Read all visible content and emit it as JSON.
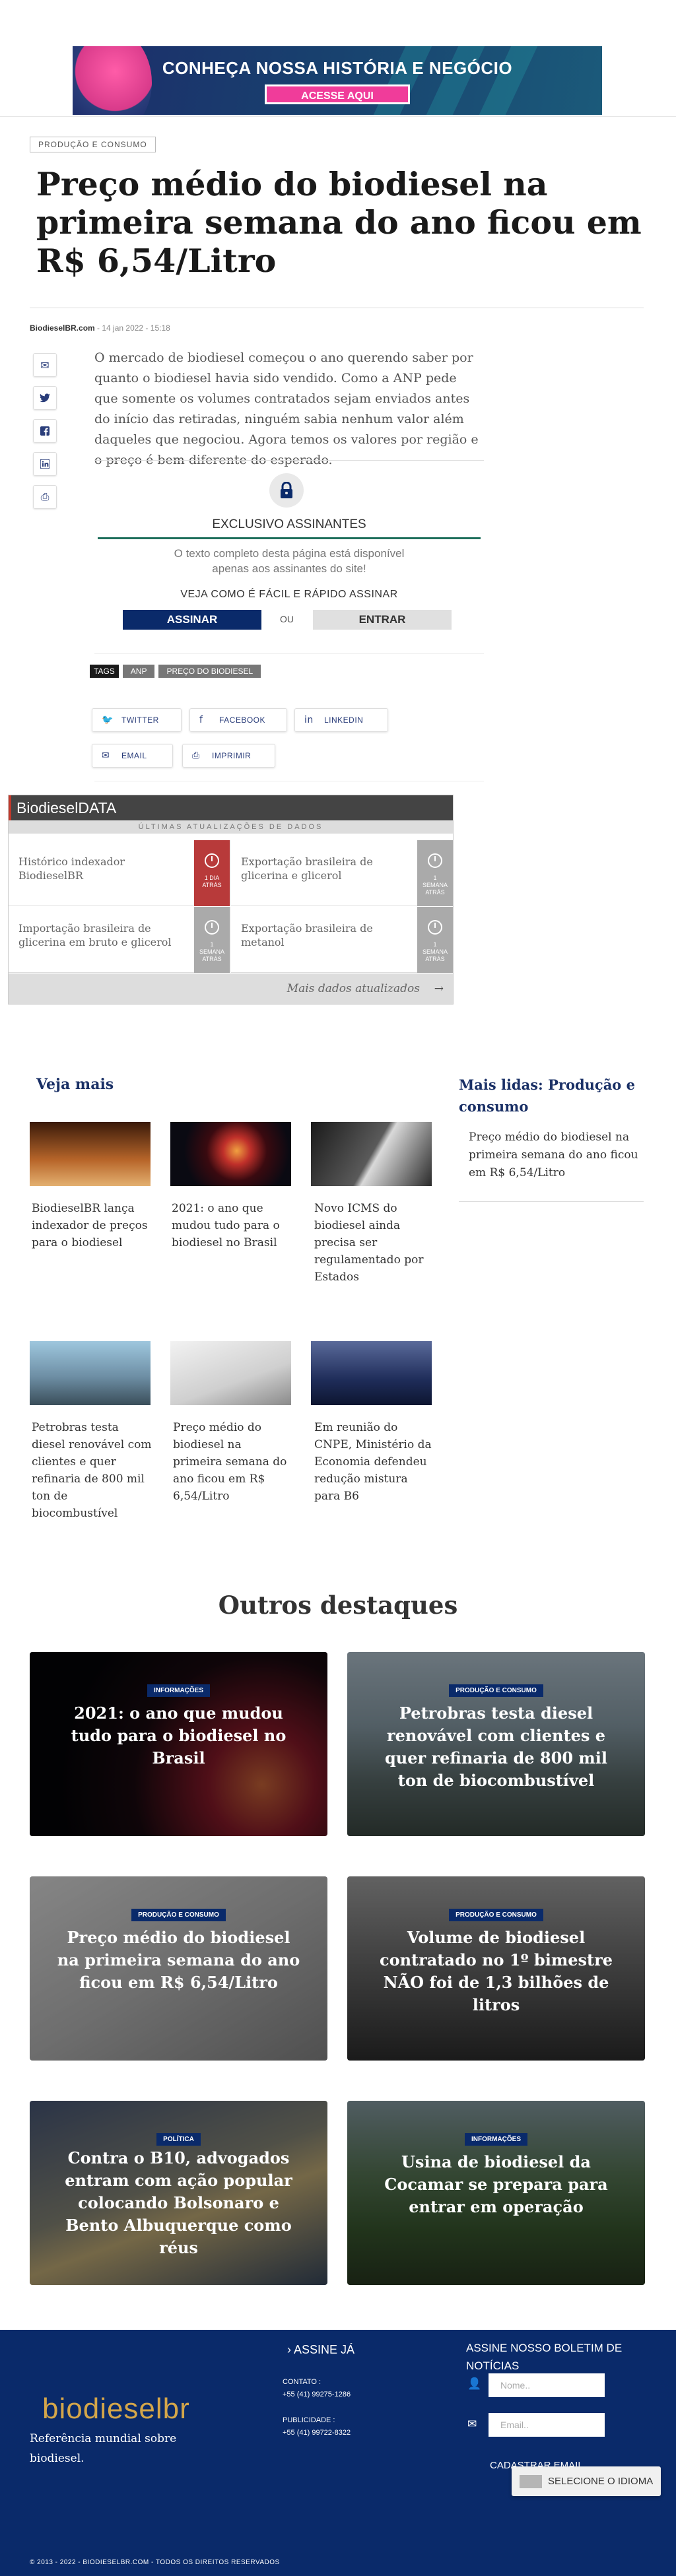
{
  "banner": {
    "headline": "CONHEÇA NOSSA HISTÓRIA E NEGÓCIO",
    "cta": "ACESSE AQUI"
  },
  "article": {
    "category": "PRODUÇÃO E CONSUMO",
    "title": "Preço médio do biodiesel na primeira semana do ano ficou em R$ 6,54/Litro",
    "author": "BiodieselBR.com",
    "date": "14 jan 2022 - 15:18",
    "lede": "O mercado de biodiesel começou o ano querendo saber por quanto o biodiesel havia sido vendido. Como a ANP pede que somente os volumes contratados sejam enviados antes do início das retiradas, ninguém sabia nenhum valor além daqueles que negociou. Agora temos os valores por região e o preço é bem diferente do esperado."
  },
  "share_side": [
    {
      "icon": "email-icon",
      "glyph": "✉"
    },
    {
      "icon": "twitter-icon",
      "glyph": "🐦"
    },
    {
      "icon": "facebook-icon",
      "glyph": "f"
    },
    {
      "icon": "linkedin-icon",
      "glyph": "in"
    },
    {
      "icon": "print-icon",
      "glyph": "⎙"
    }
  ],
  "exclusive": {
    "title": "EXCLUSIVO ASSINANTES",
    "text": "O texto completo desta página está disponível apenas aos assinantes do site!",
    "cta": "VEJA COMO É FÁCIL E RÁPIDO ASSINAR",
    "subscribe": "ASSINAR",
    "or": "OU",
    "login": "ENTRAR"
  },
  "tags": {
    "label": "TAGS",
    "items": [
      "ANP",
      "PREÇO DO BIODIESEL"
    ]
  },
  "share_buttons": {
    "twitter": "TWITTER",
    "facebook": "FACEBOOK",
    "linkedin": "LINKEDIN",
    "email": "EMAIL",
    "print": "IMPRIMIR"
  },
  "biodieseldata": {
    "title": "BiodieselDATA",
    "subtitle": "ÚLTIMAS ATUALIZAÇÕES DE DADOS",
    "items": [
      {
        "label": "Histórico indexador BiodieselBR",
        "age_num": "1 DIA",
        "age_unit": "ATRÁS",
        "color": "#b83a3a"
      },
      {
        "label": "Exportação brasileira de glicerina e glicerol",
        "age_num": "1",
        "age_unit": "SEMANA ATRÁS",
        "color": "#aaaaaa"
      },
      {
        "label": "Importação brasileira de glicerina em bruto e glicerol",
        "age_num": "1",
        "age_unit": "SEMANA ATRÁS",
        "color": "#aaaaaa"
      },
      {
        "label": "Exportação brasileira de metanol",
        "age_num": "1",
        "age_unit": "SEMANA ATRÁS",
        "color": "#aaaaaa"
      }
    ],
    "more": "Mais dados atualizados"
  },
  "veja_mais": {
    "title": "Veja mais",
    "items": [
      "BiodieselBR lança indexador de preços para o biodiesel",
      "2021: o ano que mudou tudo para o biodiesel no Brasil",
      "Novo ICMS do biodiesel ainda precisa ser regulamentado por Estados",
      "Petrobras testa diesel renovável com clientes e quer refinaria de 800 mil ton de biocombustível",
      "Preço médio do biodiesel na primeira semana do ano ficou em R$ 6,54/Litro",
      "Em reunião do CNPE, Ministério da Economia defendeu redução mistura para B6"
    ]
  },
  "mais_lidas": {
    "title": "Mais lidas: Produção e consumo",
    "items": [
      "Preço médio do biodiesel na primeira semana do ano ficou em R$ 6,54/Litro"
    ]
  },
  "outros": {
    "title": "Outros destaques",
    "items": [
      {
        "badge": "INFORMAÇÕES",
        "title": "2021: o ano que mudou tudo para o biodiesel no Brasil"
      },
      {
        "badge": "PRODUÇÃO E CONSUMO",
        "title": "Petrobras testa diesel renovável com clientes e quer refinaria de 800 mil ton de biocombustível"
      },
      {
        "badge": "PRODUÇÃO E CONSUMO",
        "title": "Preço médio do biodiesel na primeira semana do ano ficou em R$ 6,54/Litro"
      },
      {
        "badge": "PRODUÇÃO E CONSUMO",
        "title": "Volume de biodiesel contratado no 1º bimestre NÃO foi de 1,3 bilhões de litros"
      },
      {
        "badge": "POLÍTICA",
        "title": "Contra o B10, advogados entram com ação popular colocando Bolsonaro e Bento Albuquerque como réus"
      },
      {
        "badge": "INFORMAÇÕES",
        "title": "Usina de biodiesel da Cocamar se prepara para entrar em operação"
      }
    ]
  },
  "footer": {
    "logo": "biodieselbr",
    "tagline": "Referência mundial sobre biodiesel.",
    "assine": "ASSINE JÁ",
    "contato_label": "CONTATO :",
    "contato_value": "+55 (41) 99275-1286",
    "publicidade_label": "PUBLICIDADE :",
    "publicidade_value": "+55 (41) 99722-8322",
    "newsletter": "ASSINE NOSSO BOLETIM DE NOTÍCIAS",
    "name_placeholder": "Nome..",
    "email_placeholder": "Email..",
    "register": "CADASTRAR EMAIL",
    "language": "SELECIONE O IDIOMA",
    "copyright": "© 2013 - 2022 - BIODIESELBR.COM - TODOS OS DIREITOS RESERVADOS"
  }
}
